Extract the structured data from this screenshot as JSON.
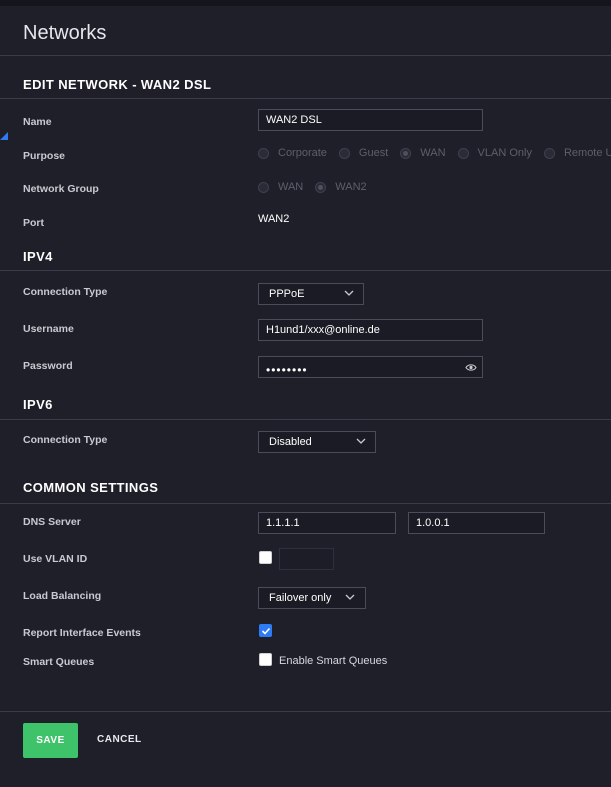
{
  "page": {
    "title": "Networks"
  },
  "edit_section": {
    "title": "EDIT NETWORK - WAN2 DSL",
    "name_label": "Name",
    "name_value": "WAN2 DSL",
    "purpose_label": "Purpose",
    "purpose_options": [
      "Corporate",
      "Guest",
      "WAN",
      "VLAN Only",
      "Remote U"
    ],
    "purpose_selected": "WAN",
    "network_group_label": "Network Group",
    "network_group_options": [
      "WAN",
      "WAN2"
    ],
    "network_group_selected": "WAN2",
    "port_label": "Port",
    "port_value": "WAN2"
  },
  "ipv4": {
    "title": "IPV4",
    "connection_type_label": "Connection Type",
    "connection_type_value": "PPPoE",
    "username_label": "Username",
    "username_value": "H1und1/xxx@online.de",
    "password_label": "Password",
    "password_mask": "••••••••"
  },
  "ipv6": {
    "title": "IPV6",
    "connection_type_label": "Connection Type",
    "connection_type_value": "Disabled"
  },
  "common": {
    "title": "COMMON SETTINGS",
    "dns_label": "DNS Server",
    "dns_primary": "1.1.1.1",
    "dns_secondary": "1.0.0.1",
    "vlan_label": "Use VLAN ID",
    "vlan_checked": false,
    "vlan_value": "",
    "load_balancing_label": "Load Balancing",
    "load_balancing_value": "Failover only",
    "report_events_label": "Report Interface Events",
    "report_events_checked": true,
    "smart_queues_label": "Smart Queues",
    "smart_queues_checked": false,
    "smart_queues_checkbox_label": "Enable Smart Queues"
  },
  "actions": {
    "save_label": "SAVE",
    "cancel_label": "CANCEL"
  },
  "colors": {
    "background": "#1e1f29",
    "accent_blue": "#2d7cf6",
    "save_green": "#3ec36a"
  },
  "icons": {
    "eye": "eye-icon",
    "chevron": "chevron-down-icon",
    "check": "check-icon"
  }
}
